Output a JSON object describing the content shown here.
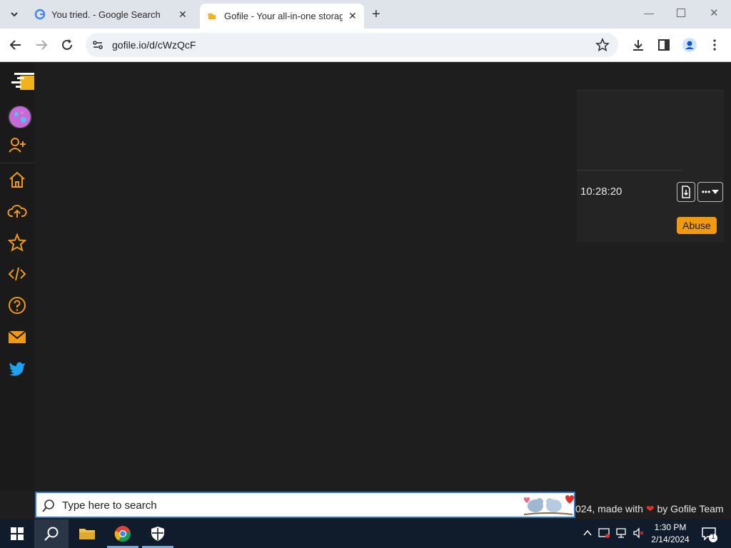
{
  "browser": {
    "tabs": [
      {
        "title": "You tried. - Google Search",
        "icon": "google-g-icon"
      },
      {
        "title": "Gofile - Your all-in-one storage",
        "icon": "gofile-favicon-icon"
      }
    ],
    "url": "gofile.io/d/cWzQcF"
  },
  "sidebar": {
    "items": [
      "gofile-logo-icon",
      "avatar",
      "add-user-icon",
      "home-icon",
      "upload-cloud-icon",
      "star-icon",
      "code-icon",
      "help-icon",
      "mail-icon",
      "twitter-icon"
    ]
  },
  "card": {
    "time": "10:28:20",
    "abuse_label": "Abuse",
    "more_label": "•••"
  },
  "footer": {
    "text_before": "024, made with",
    "text_after": "by Gofile Team"
  },
  "search": {
    "placeholder": "Type here to search"
  },
  "taskbar": {
    "time": "1:30 PM",
    "date": "2/14/2024",
    "notification_count": "1"
  },
  "colors": {
    "accent": "#f09a12",
    "page_bg": "#1e1e1e",
    "taskbar_bg": "#101c2c"
  }
}
